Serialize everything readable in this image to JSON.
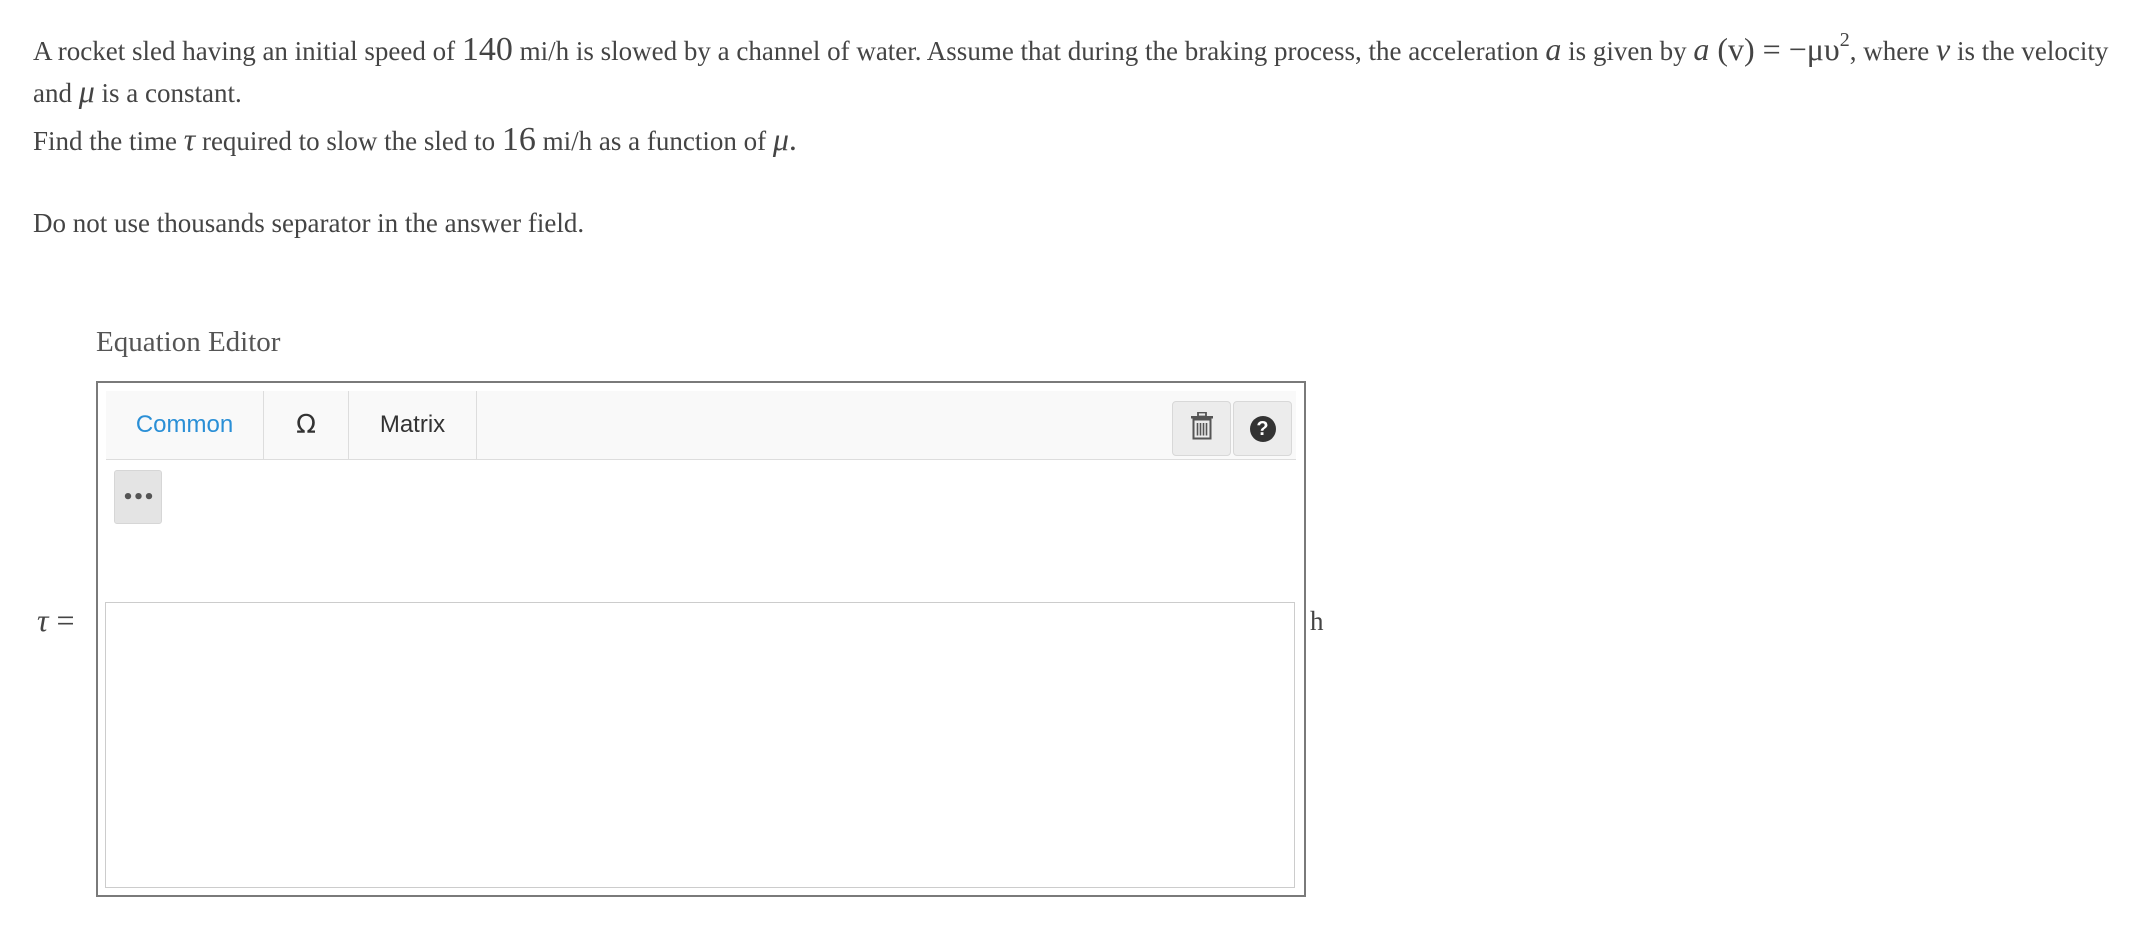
{
  "problem": {
    "intro_a": "A rocket sled having an initial speed of ",
    "initial_speed": "140",
    "intro_b": " mi/h is slowed by a channel of water. Assume that during the braking process, the acceleration ",
    "accel_symbol": "a",
    "intro_c": " is given by ",
    "formula_lhs": "a",
    "formula_arg": " (v) = −μυ",
    "formula_exp": "2",
    "intro_d": ", where ",
    "velocity_symbol": "v",
    "intro_e": " is the velocity and ",
    "mu_symbol": "μ",
    "intro_f": " is a constant.",
    "find_a": "Find the time ",
    "tau_symbol": "τ",
    "find_b": " required to slow the sled to ",
    "final_speed": "16",
    "find_c": " mi/h as a function of ",
    "find_mu": "μ",
    "find_end": ".",
    "note": "Do not use thousands separator in the answer field."
  },
  "editor": {
    "title": "Equation Editor",
    "tabs": [
      "Common",
      "Ω",
      "Matrix"
    ],
    "active_tab": "Common",
    "more_label": "•••",
    "help_label": "?",
    "trash_icon": "trash-icon",
    "answer_value": ""
  },
  "answer": {
    "tau": "τ",
    "equals": " =",
    "unit": "h"
  },
  "colors": {
    "accent": "#2a8fd6",
    "text": "#444444",
    "frame_border": "#7a7a7a"
  }
}
